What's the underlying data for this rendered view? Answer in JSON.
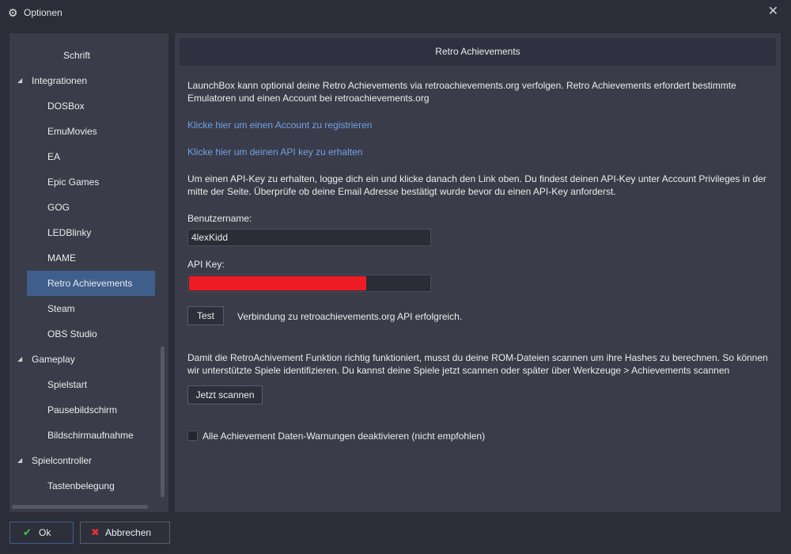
{
  "window": {
    "title": "Optionen"
  },
  "sidebar": {
    "items": [
      {
        "label": "Schrift"
      },
      {
        "label": "Integrationen"
      },
      {
        "label": "DOSBox"
      },
      {
        "label": "EmuMovies"
      },
      {
        "label": "EA"
      },
      {
        "label": "Epic Games"
      },
      {
        "label": "GOG"
      },
      {
        "label": "LEDBlinky"
      },
      {
        "label": "MAME"
      },
      {
        "label": "Retro Achievements"
      },
      {
        "label": "Steam"
      },
      {
        "label": "OBS Studio"
      },
      {
        "label": "Gameplay"
      },
      {
        "label": "Spielstart"
      },
      {
        "label": "Pausebildschirm"
      },
      {
        "label": "Bildschirmaufnahme"
      },
      {
        "label": "Spielcontroller"
      },
      {
        "label": "Tastenbelegung"
      }
    ],
    "selected": "Retro Achievements"
  },
  "content": {
    "header": "Retro Achievements",
    "intro_line1": "LaunchBox kann optional deine Retro Achievements via retroachievements.org verfolgen. Retro Achievements erfordert bestimmte",
    "intro_line2": "Emulatoren und einen Account bei retroachievements.org",
    "link_register": "Klicke hier um einen Account zu registrieren",
    "link_apikey": "Klicke hier um deinen API key zu erhalten",
    "info_line1": "Um einen API-Key zu erhalten, logge dich ein und klicke danach den Link oben. Du findest deinen API-Key unter Account Privileges in der",
    "info_line2": "mitte der Seite. Überprüfe ob deine Email Adresse bestätigt wurde bevor du einen API-Key anforderst.",
    "username_label": "Benutzername:",
    "username_value": "4lexKidd",
    "apikey_label": "API Key:",
    "apikey_redacted_color": "#ed1c24",
    "test_button": "Test",
    "test_status": "Verbindung zu retroachievements.org API erfolgreich.",
    "scan_line1": "Damit die RetroAchivement Funktion richtig funktioniert, musst du deine ROM-Dateien scannen um ihre Hashes zu berechnen. So können",
    "scan_line2": "wir unterstützte Spiele identifizieren. Du kannst deine Spiele jetzt scannen oder später über Werkzeuge > Achievements scannen",
    "scan_button": "Jetzt scannen",
    "checkbox_label": "Alle Achievement Daten-Warnungen deaktivieren (nicht empfohlen)",
    "checkbox_checked": false
  },
  "footer": {
    "ok_label": "Ok",
    "cancel_label": "Abbrechen"
  },
  "colors": {
    "background": "#2b2d38",
    "panel": "#3a3c49",
    "selected": "#3f5e8c",
    "link": "#6fa1e6",
    "ok_icon": "#4cc04c",
    "cancel_icon": "#e03131"
  },
  "icons": {
    "title": "gear-icon",
    "close": "close-icon",
    "expanded": "triangle-expanded-icon",
    "ok": "check-icon",
    "cancel": "cross-icon"
  }
}
